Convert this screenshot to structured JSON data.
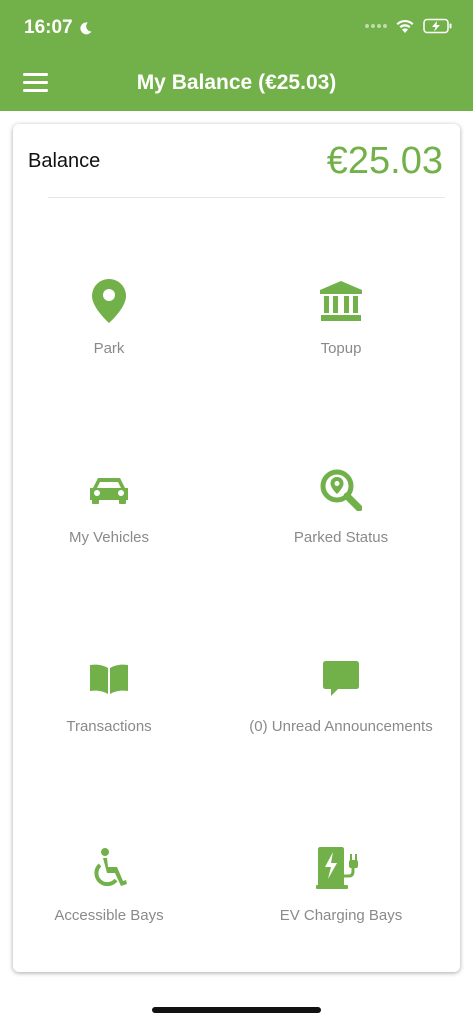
{
  "status_bar": {
    "time": "16:07"
  },
  "header": {
    "title": "My Balance (€25.03)"
  },
  "balance": {
    "label": "Balance",
    "amount": "€25.03"
  },
  "tiles": [
    {
      "label": "Park",
      "icon": "map-pin-icon"
    },
    {
      "label": "Topup",
      "icon": "bank-icon"
    },
    {
      "label": "My Vehicles",
      "icon": "car-icon"
    },
    {
      "label": "Parked Status",
      "icon": "magnifier-pin-icon"
    },
    {
      "label": "Transactions",
      "icon": "book-icon"
    },
    {
      "label": "(0) Unread Announcements",
      "icon": "speech-bubble-icon"
    },
    {
      "label": "Accessible Bays",
      "icon": "wheelchair-icon"
    },
    {
      "label": "EV Charging Bays",
      "icon": "ev-charger-icon"
    }
  ],
  "colors": {
    "brand": "#72b04a",
    "label_gray": "#8a8a8a"
  }
}
